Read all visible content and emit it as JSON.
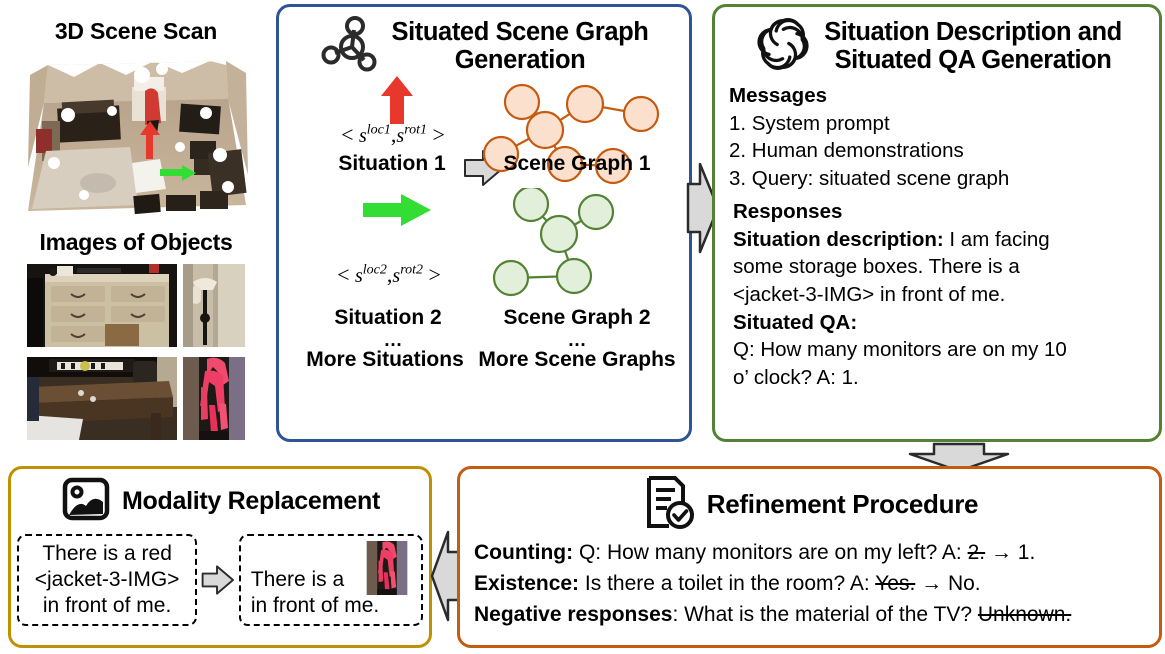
{
  "scene": {
    "scan_title": "3D Scene Scan",
    "objects_title": "Images of Objects",
    "scan_alt": "point-cloud-room-scan",
    "arrows": [
      {
        "name": "red-situation-arrow",
        "color": "#E8372B",
        "direction": "up"
      },
      {
        "name": "green-situation-arrow",
        "color": "#33DD33",
        "direction": "right"
      }
    ],
    "object_images": [
      {
        "name": "object-image-dresser",
        "alt": "dresser"
      },
      {
        "name": "object-image-floor-lamp",
        "alt": "floor lamp"
      },
      {
        "name": "object-image-desk",
        "alt": "desk"
      },
      {
        "name": "object-image-pink-jacket",
        "alt": "pink jacket"
      }
    ]
  },
  "scene_graph_panel": {
    "icon": "graph-nodes-icon",
    "title_line1": "Situated Scene Graph",
    "title_line2": "Generation",
    "border_color": "#2E5496",
    "situation1": {
      "math_open": "<",
      "math_s": "s",
      "math_sup1": "loc1",
      "math_comma": ",",
      "math_s2": "s",
      "math_sup2": "rot1",
      "math_close": ">",
      "label": "Situation 1"
    },
    "situation2": {
      "math_open": "<",
      "math_s": "s",
      "math_sup1": "loc2",
      "math_comma": ",",
      "math_s2": "s",
      "math_sup2": "rot2",
      "math_close": ">",
      "label": "Situation 2"
    },
    "graph1_label": "Scene Graph 1",
    "graph2_label": "Scene Graph 2",
    "ellipsis": "…",
    "more_situations": "More Situations",
    "more_graphs": "More Scene Graphs",
    "graph1_color_fill": "#FBE0CE",
    "graph1_color_stroke": "#C55A11",
    "graph2_color_fill": "#E2EFDA",
    "graph2_color_stroke": "#548235"
  },
  "qa_panel": {
    "icon": "openai-logo-icon",
    "title_line1": "Situation Description and",
    "title_line2": "Situated QA Generation",
    "border_color": "#548235",
    "messages_heading": "Messages",
    "messages": [
      "1. System prompt",
      "2. Human demonstrations",
      "3. Query: situated scene graph"
    ],
    "responses_heading": "Responses",
    "situation_desc_label": "Situation description:",
    "situation_desc_text": " I am facing",
    "situation_desc_line2": "some storage boxes. There is a",
    "situation_desc_line3": "<jacket-3-IMG> in front of me.",
    "qa_label": "Situated QA:",
    "qa_line1": "Q: How many monitors are on my 10",
    "qa_line2": "o’ clock? A: 1."
  },
  "modality_panel": {
    "icon": "image-photo-icon",
    "title": "Modality Replacement",
    "border_color": "#BF9000",
    "source_lines": [
      "There is a red",
      "<jacket-3-IMG>",
      "in front of me."
    ],
    "target_line1": "There is a",
    "target_line2": "in front  of me.",
    "target_image_alt": "pink jacket"
  },
  "refinement_panel": {
    "icon": "document-check-icon",
    "title": "Refinement Procedure",
    "border_color": "#C55A11",
    "rows": [
      {
        "label": "Counting:",
        "text_before": " Q: How many monitors are on my left?  A: ",
        "struck": "2.",
        "arrow": " → ",
        "corrected": "1."
      },
      {
        "label": "Existence:",
        "text_before": " Is there a toilet in the room? A: ",
        "struck": "Yes.",
        "arrow": " → ",
        "corrected": "No."
      },
      {
        "label": "Negative responses",
        "text_before": ": What is the material of the TV? ",
        "struck": "Unknown.",
        "arrow": "",
        "corrected": ""
      }
    ]
  },
  "connectors": [
    {
      "name": "connector-arrow-sg-to-qa",
      "direction": "right",
      "color": "#D9D9D9"
    },
    {
      "name": "connector-arrow-qa-to-refinement",
      "direction": "down",
      "color": "#D9D9D9"
    },
    {
      "name": "connector-arrow-refinement-to-modality",
      "direction": "left",
      "color": "#D9D9D9"
    },
    {
      "name": "connector-arrow-situation-to-graph",
      "direction": "right",
      "color": "#D9D9D9"
    },
    {
      "name": "connector-arrow-modality-source-to-target",
      "direction": "right",
      "color": "#D9D9D9"
    }
  ]
}
